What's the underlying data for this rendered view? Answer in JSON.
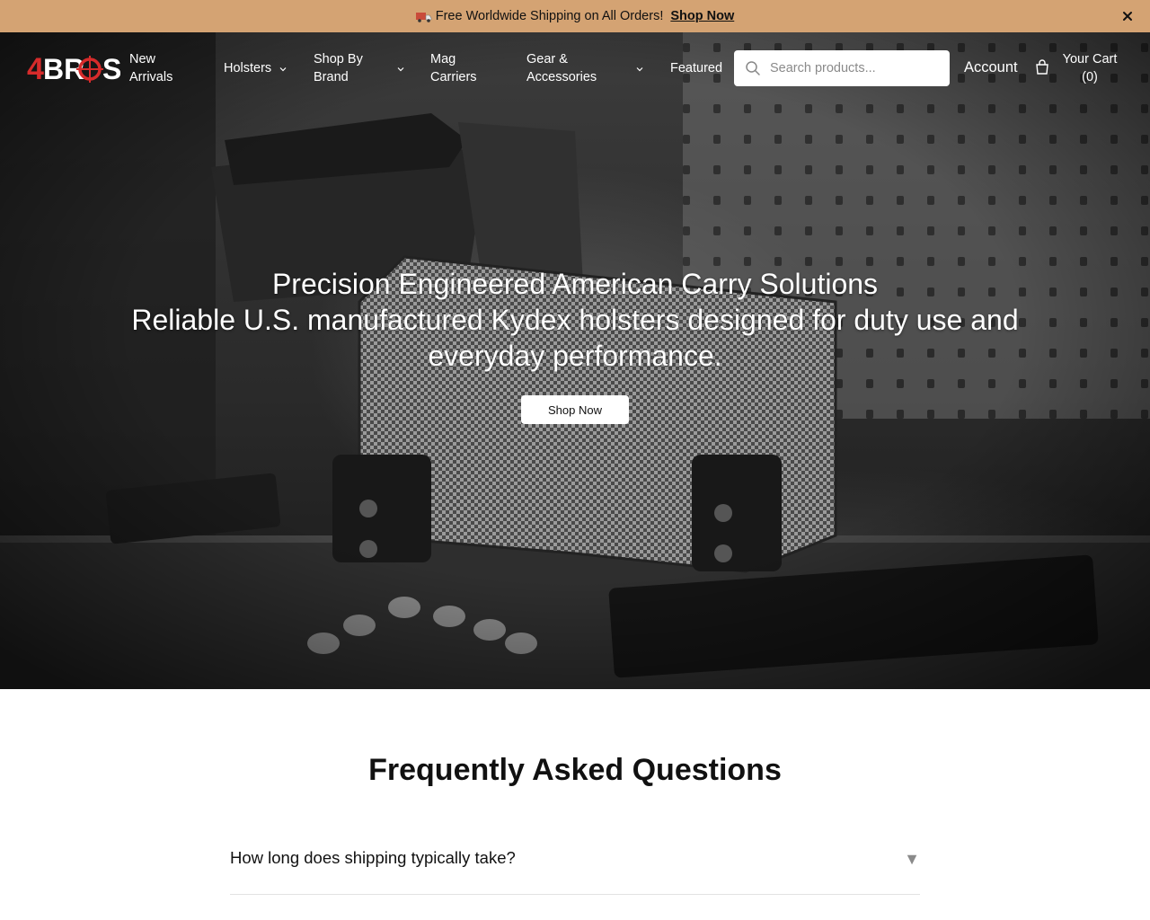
{
  "announcement": {
    "text": "Free Worldwide Shipping on All Orders!",
    "link_label": "Shop Now",
    "close_symbol": "×"
  },
  "brand": {
    "logo_text": "4BROS",
    "accent_color": "#d62b2b"
  },
  "nav": {
    "new_arrivals": [
      "New",
      "Arrivals"
    ],
    "holsters": "Holsters",
    "shop_by_brand": [
      "Shop By",
      "Brand"
    ],
    "mag_carriers": [
      "Mag",
      "Carriers"
    ],
    "gear_accessories": [
      "Gear &",
      "Accessories"
    ],
    "featured": "Featured"
  },
  "search": {
    "placeholder": "Search products..."
  },
  "account_label": "Account",
  "cart": {
    "line1": "Your Cart",
    "count_text": "(0)"
  },
  "hero": {
    "title": "Precision Engineered American Carry Solutions",
    "subtitle": "Reliable U.S. manufactured Kydex holsters designed for duty use and everyday performance.",
    "button_label": "Shop Now"
  },
  "faq": {
    "title": "Frequently Asked Questions",
    "items": [
      {
        "question": "How long does shipping typically take?",
        "arrow": "▼"
      }
    ]
  },
  "colors": {
    "announcement_bg": "#d4a373",
    "hero_dark": "#2a2a2a"
  }
}
